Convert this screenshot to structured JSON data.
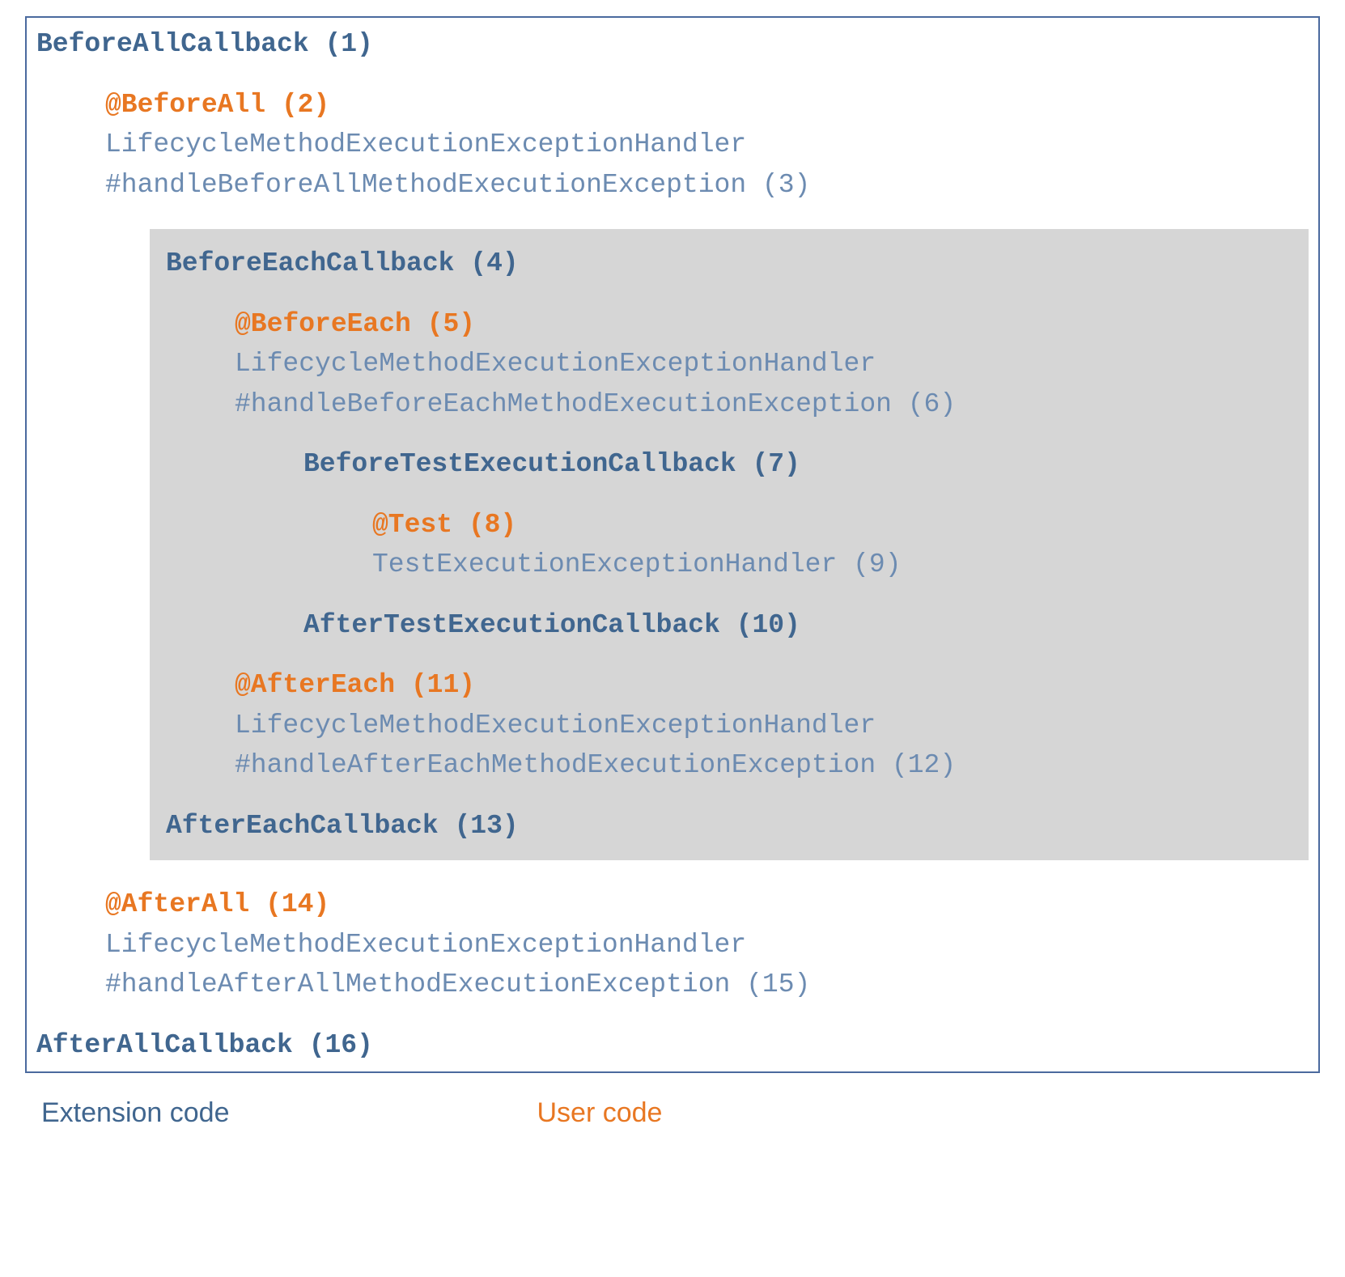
{
  "diagram": {
    "beforeAllCallback": "BeforeAllCallback (1)",
    "beforeAll": "@BeforeAll (2)",
    "beforeAllHandler1": "LifecycleMethodExecutionExceptionHandler",
    "beforeAllHandler2": "#handleBeforeAllMethodExecutionException (3)",
    "beforeEachCallback": "BeforeEachCallback (4)",
    "beforeEach": "@BeforeEach (5)",
    "beforeEachHandler1": "LifecycleMethodExecutionExceptionHandler",
    "beforeEachHandler2": "#handleBeforeEachMethodExecutionException (6)",
    "beforeTestExecCallback": "BeforeTestExecutionCallback (7)",
    "test": "@Test (8)",
    "testHandler": "TestExecutionExceptionHandler (9)",
    "afterTestExecCallback": "AfterTestExecutionCallback (10)",
    "afterEach": "@AfterEach (11)",
    "afterEachHandler1": "LifecycleMethodExecutionExceptionHandler",
    "afterEachHandler2": "#handleAfterEachMethodExecutionException (12)",
    "afterEachCallback": "AfterEachCallback (13)",
    "afterAll": "@AfterAll (14)",
    "afterAllHandler1": "LifecycleMethodExecutionExceptionHandler",
    "afterAllHandler2": "#handleAfterAllMethodExecutionException (15)",
    "afterAllCallback": "AfterAllCallback (16)"
  },
  "legend": {
    "extension": "Extension code",
    "user": "User code"
  }
}
